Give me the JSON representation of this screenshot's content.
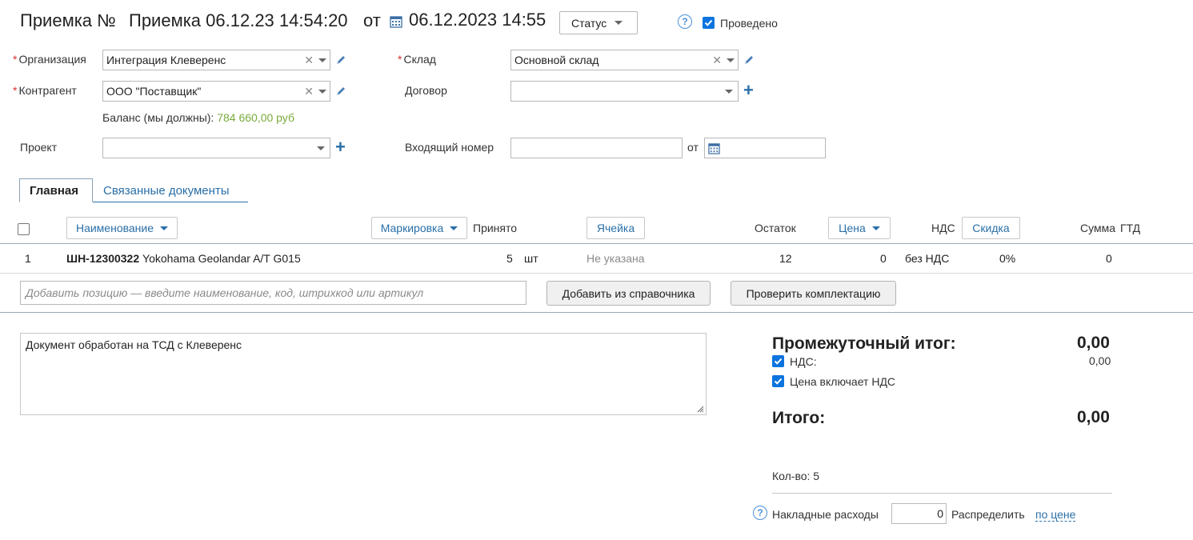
{
  "header": {
    "doc_type": "Приемка №",
    "doc_name": "Приемка 06.12.23 14:54:20",
    "from_label": "от",
    "datetime": "06.12.2023 14:55",
    "status_label": "Статус",
    "posted_label": "Проведено",
    "posted_checked": true,
    "help_symbol": "?"
  },
  "form": {
    "organization": {
      "label": "Организация",
      "value": "Интеграция Клеверенс"
    },
    "warehouse": {
      "label": "Склад",
      "value": "Основной склад"
    },
    "counterparty": {
      "label": "Контрагент",
      "value": "ООО \"Поставщик\""
    },
    "contract": {
      "label": "Договор",
      "value": ""
    },
    "balance": {
      "label": "Баланс (мы должны):",
      "value": "784 660,00 руб"
    },
    "project": {
      "label": "Проект",
      "value": ""
    },
    "incoming_number": {
      "label": "Входящий номер",
      "value": "",
      "from_label": "от",
      "date": ""
    }
  },
  "tabs": [
    {
      "label": "Главная",
      "active": true
    },
    {
      "label": "Связанные документы",
      "active": false
    }
  ],
  "table": {
    "columns": {
      "name": "Наименование",
      "marking": "Маркировка",
      "accepted": "Принято",
      "cell": "Ячейка",
      "remainder": "Остаток",
      "price": "Цена",
      "vat": "НДС",
      "discount": "Скидка",
      "sum": "Сумма",
      "gtd": "ГТД"
    },
    "rows": [
      {
        "num": "1",
        "code": "ШН-12300322",
        "name": "Yokohama Geolandar A/T G015",
        "qty": "5",
        "unit": "шт",
        "cell": "Не указана",
        "remainder": "12",
        "price": "0",
        "vat": "без НДС",
        "discount": "0%",
        "sum": "0"
      }
    ]
  },
  "add_position": {
    "placeholder": "Добавить позицию — введите наименование, код, штрихкод или артикул",
    "from_catalog_btn": "Добавить из справочника",
    "check_btn": "Проверить комплектацию"
  },
  "comment": "Документ обработан на ТСД с Клеверенс",
  "totals": {
    "subtotal_label": "Промежуточный итог:",
    "subtotal_value": "0,00",
    "vat_label": "НДС:",
    "vat_value": "0,00",
    "vat_checked": true,
    "price_incl_vat_label": "Цена включает НДС",
    "price_incl_vat_checked": true,
    "total_label": "Итого:",
    "total_value": "0,00",
    "qty_label": "Кол-во: 5",
    "overhead_label": "Накладные расходы",
    "overhead_value": "0",
    "distribute_label": "Распределить",
    "distribute_link": "по цене"
  },
  "colors": {
    "link": "#2a6fa8",
    "required": "#d9302c",
    "balance": "#7aab3b",
    "checkbox": "#0b74de"
  }
}
